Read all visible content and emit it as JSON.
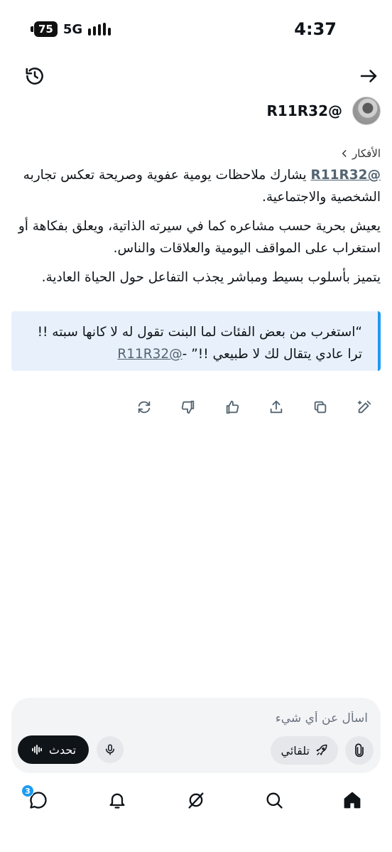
{
  "status_bar": {
    "battery": "75",
    "network": "5G",
    "time": "4:37"
  },
  "profile": {
    "handle": "@R11R32"
  },
  "content": {
    "section_link": "الأفكار",
    "para1_mention": "@R11R32",
    "para1_text": " يشارك ملاحظات يومية عفوية وصريحة تعكس تجاربه الشخصية والاجتماعية.",
    "para2": "يعيش بحرية حسب مشاعره كما في سيرته الذاتية، ويعلق بفكاهة أو استغراب على المواقف اليومية والعلاقات والناس.",
    "para3": "يتميز بأسلوب بسيط ومباشر يجذب التفاعل حول الحياة العادية."
  },
  "quote": {
    "text": "“استغرب من بعض الفئات لما البنت تقول له لا كانها سبته !! ترا عادي يتقال لك لا طبيعي !!” -",
    "mention": "@R11R32"
  },
  "composer": {
    "placeholder": "اسأل عن أي شيء",
    "auto_label": "تلقائي",
    "talk_label": "تحدث"
  },
  "bottom_nav": {
    "messages_badge": "3"
  }
}
